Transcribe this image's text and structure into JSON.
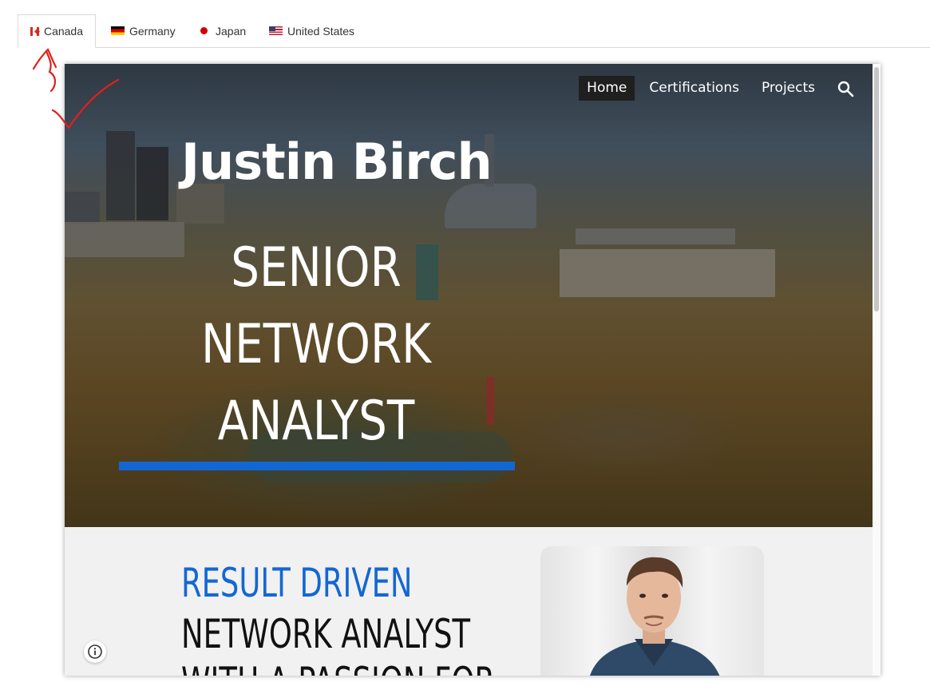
{
  "tabs": [
    {
      "label": "Canada",
      "flag": "flag-canada-icon",
      "active": true
    },
    {
      "label": "Germany",
      "flag": "flag-germany-icon",
      "active": false
    },
    {
      "label": "Japan",
      "flag": "flag-japan-icon",
      "active": false
    },
    {
      "label": "United States",
      "flag": "flag-us-icon",
      "active": false
    }
  ],
  "site": {
    "nav": {
      "items": [
        "Home",
        "Certifications",
        "Projects"
      ],
      "current": "Home",
      "search_icon": "search-icon"
    },
    "hero": {
      "name": "Justin Birch",
      "title_lines": [
        "SENIOR",
        "NETWORK",
        "ANALYST"
      ],
      "accent_color": "#1367d3"
    },
    "section": {
      "tagline_accent": "RESULT DRIVEN",
      "tagline_line2": "NETWORK ANALYST",
      "tagline_line3": "WITH A PASSION FOR",
      "accent_color": "#1367d3"
    },
    "info_icon": "info-icon"
  },
  "annotation": {
    "color": "#e0201b",
    "shape": "hand-drawn-arrow-and-checkmark"
  }
}
